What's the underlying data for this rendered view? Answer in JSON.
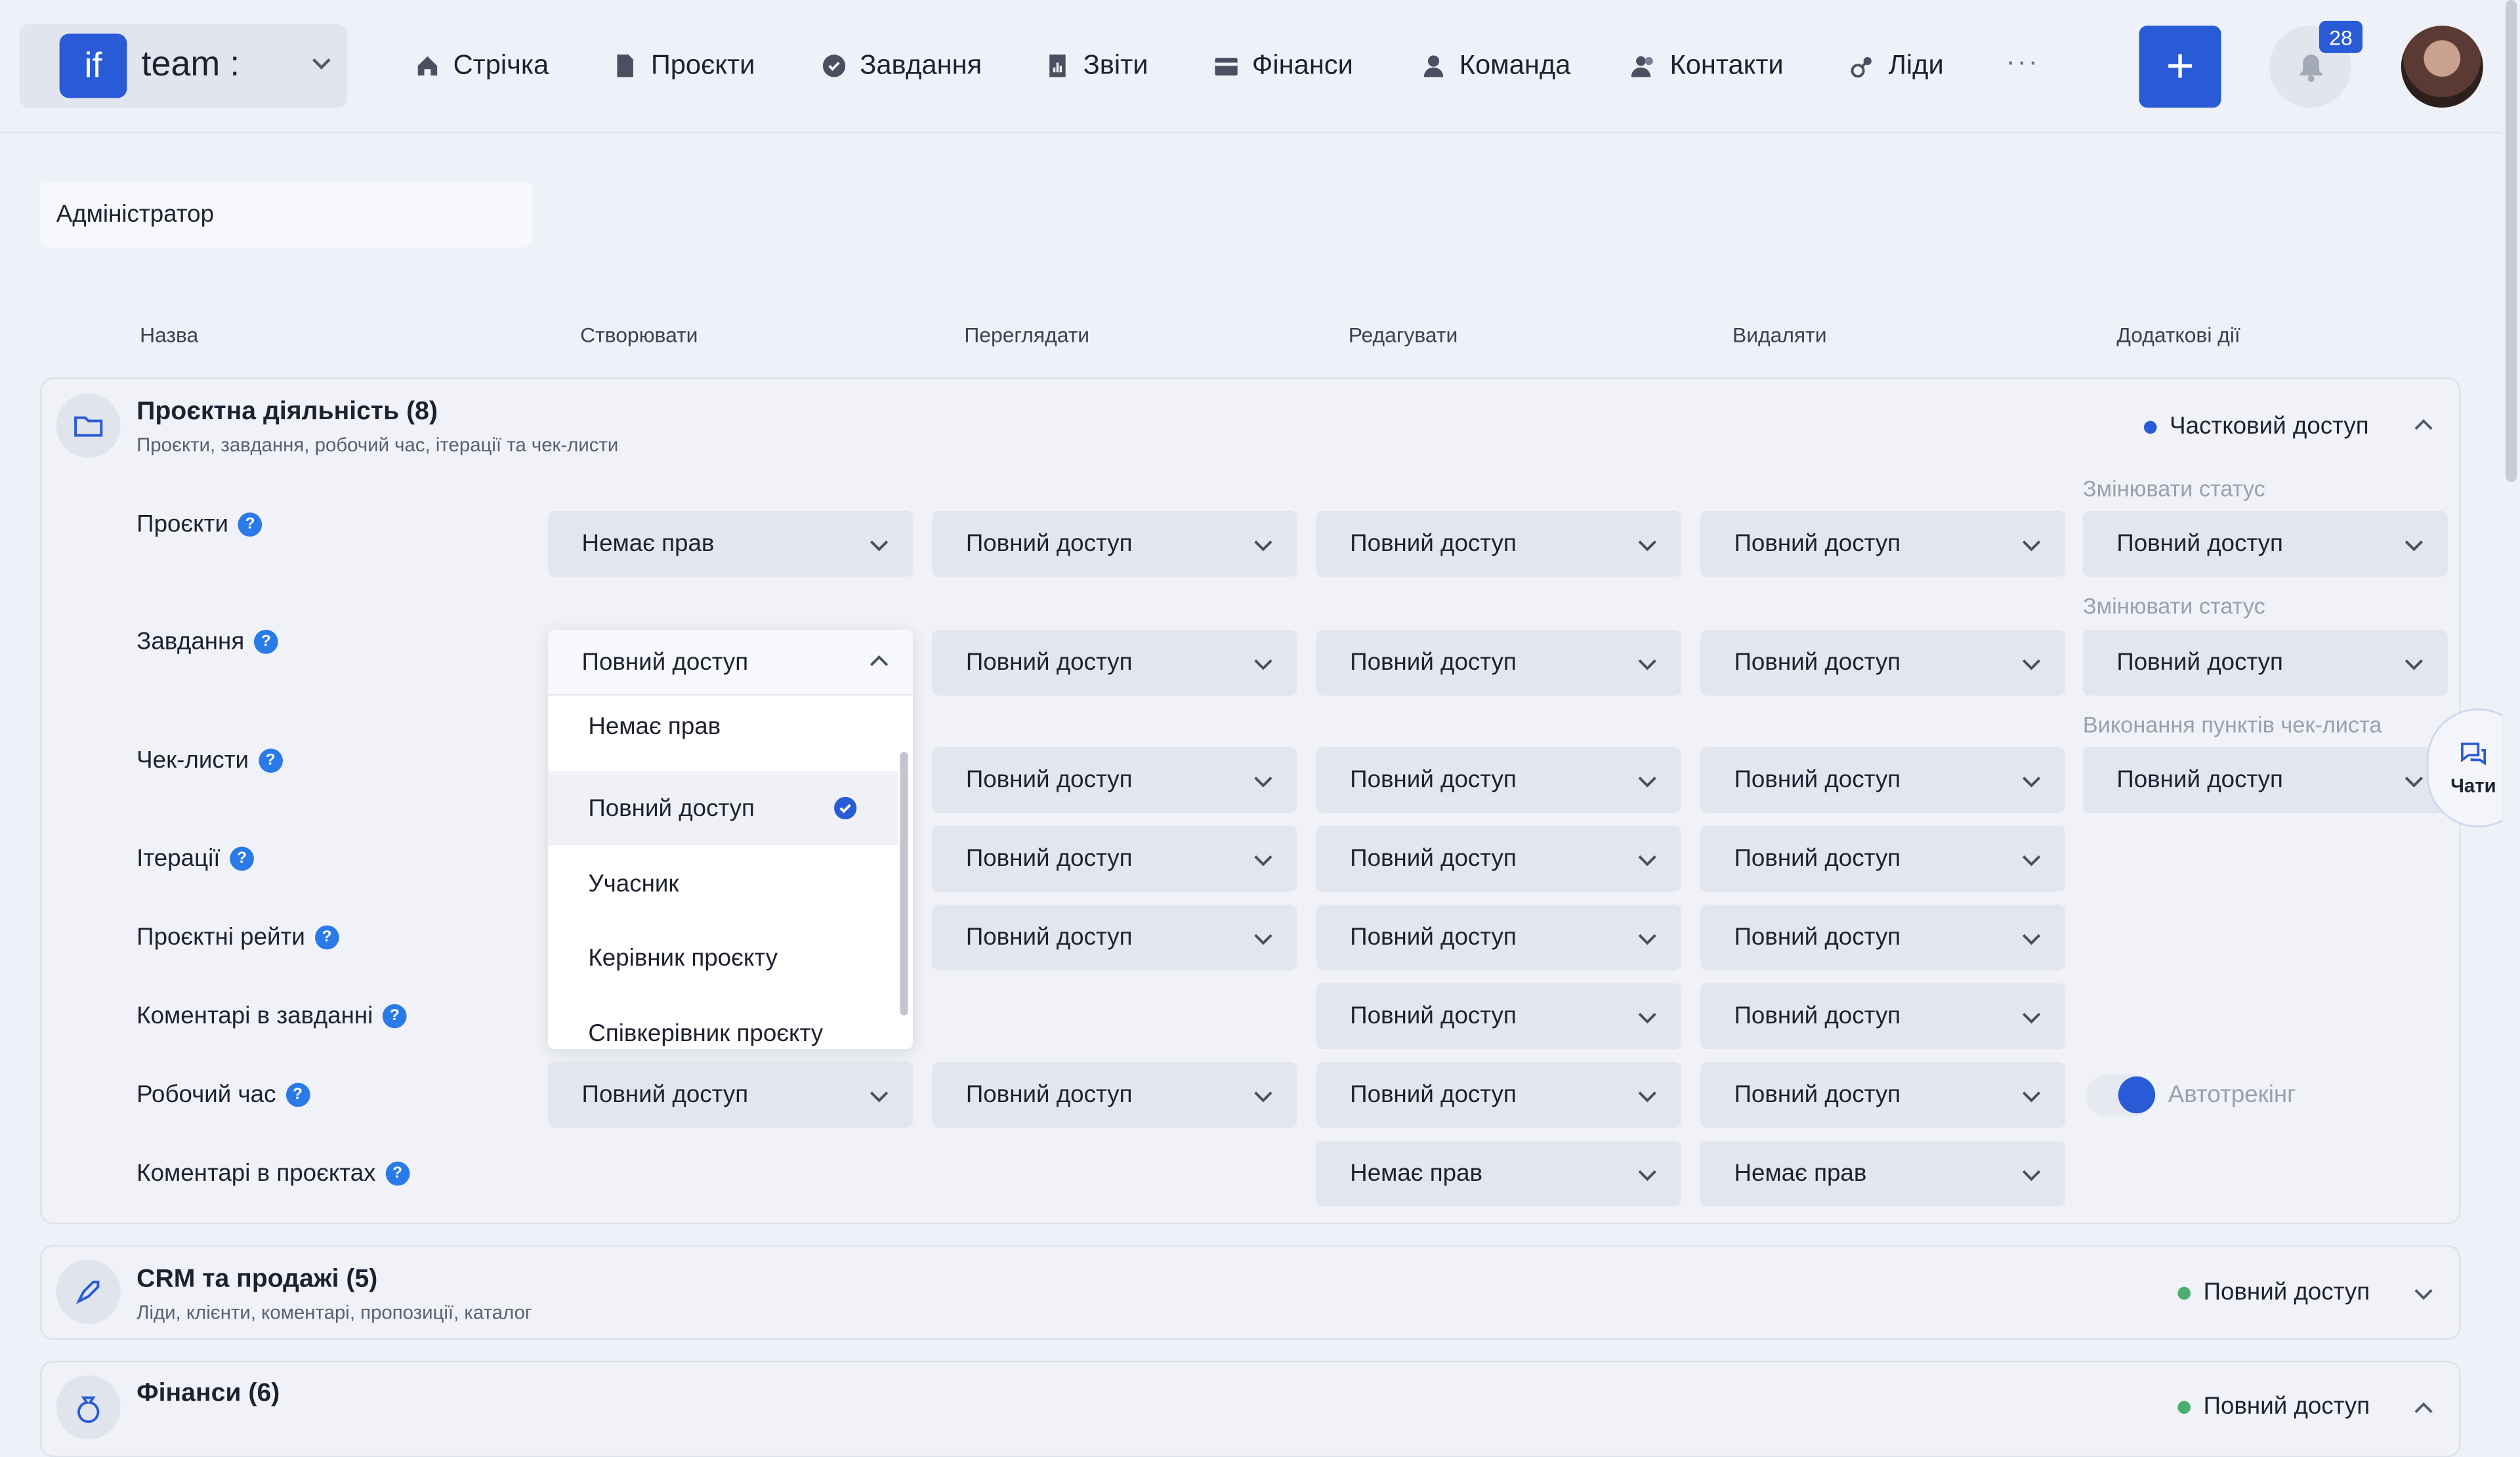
{
  "header": {
    "logo_text": "if",
    "workspace": "team :",
    "nav": [
      {
        "label": "Стрічка",
        "icon": "home-icon"
      },
      {
        "label": "Проєкти",
        "icon": "document-icon"
      },
      {
        "label": "Завдання",
        "icon": "check-circle-icon"
      },
      {
        "label": "Звіти",
        "icon": "report-icon"
      },
      {
        "label": "Фінанси",
        "icon": "wallet-icon"
      },
      {
        "label": "Команда",
        "icon": "person-icon"
      },
      {
        "label": "Контакти",
        "icon": "contacts-icon"
      },
      {
        "label": "Ліди",
        "icon": "leads-icon"
      }
    ],
    "more": "···",
    "add_label": "+",
    "notifications": "28"
  },
  "role_value": "Адміністратор",
  "columns": [
    "Назва",
    "Створювати",
    "Переглядати",
    "Редагувати",
    "Видаляти",
    "Додаткові дії"
  ],
  "sections": [
    {
      "title": "Проєктна діяльність (8)",
      "subtitle": "Проєкти, завдання, робочий час, ітерації та чек-листи",
      "access": "Частковий доступ",
      "access_color": "#2a5bd7"
    },
    {
      "title": "CRM та продажі (5)",
      "subtitle": "Ліди, клієнти, коментарі, пропозиції, каталог",
      "access": "Повний доступ",
      "access_color": "#4cae6e"
    },
    {
      "title": "Фінанси (6)",
      "subtitle": "",
      "access": "Повний доступ",
      "access_color": "#4cae6e"
    }
  ],
  "rows": [
    {
      "label": "Проєкти",
      "create": "Немає прав",
      "view": "Повний доступ",
      "edit": "Повний доступ",
      "delete": "Повний доступ",
      "extra_label": "Змінювати статус",
      "extra": "Повний доступ"
    },
    {
      "label": "Завдання",
      "create": "Повний доступ",
      "view": "Повний доступ",
      "edit": "Повний доступ",
      "delete": "Повний доступ",
      "extra_label": "Змінювати статус",
      "extra": "Повний доступ"
    },
    {
      "label": "Чек-листи",
      "view": "Повний доступ",
      "edit": "Повний доступ",
      "delete": "Повний доступ",
      "extra_label": "Виконання пунктів чек-листа",
      "extra": "Повний доступ"
    },
    {
      "label": "Ітерації",
      "view": "Повний доступ",
      "edit": "Повний доступ",
      "delete": "Повний доступ"
    },
    {
      "label": "Проєктні рейти",
      "view": "Повний доступ",
      "edit": "Повний доступ",
      "delete": "Повний доступ"
    },
    {
      "label": "Коментарі в завданні",
      "edit": "Повний доступ",
      "delete": "Повний доступ"
    },
    {
      "label": "Робочий час",
      "create": "Повний доступ",
      "view": "Повний доступ",
      "edit": "Повний доступ",
      "delete": "Повний доступ",
      "extra": "Автотрекінг"
    },
    {
      "label": "Коментарі в проєктах",
      "edit": "Немає прав",
      "delete": "Немає прав"
    }
  ],
  "dropdown": {
    "options": [
      "Немає прав",
      "Повний доступ",
      "Учасник",
      "Керівник проєкту",
      "Співкерівник проєкту"
    ],
    "selected": "Повний доступ"
  },
  "chat_label": "Чати"
}
